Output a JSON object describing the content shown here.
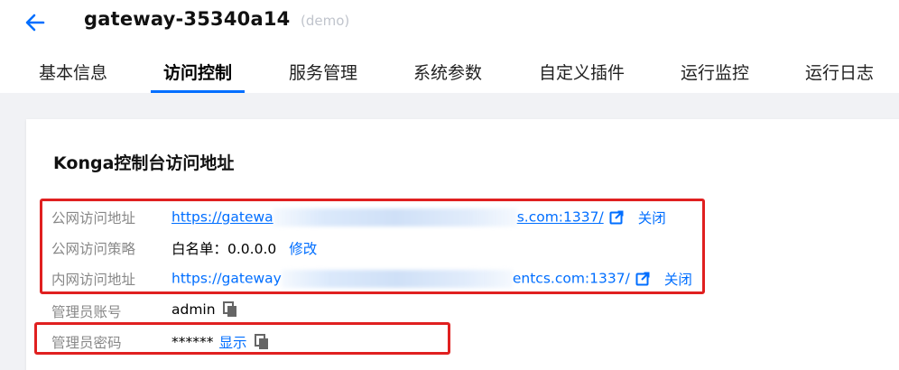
{
  "header": {
    "title": "gateway-35340a14",
    "tag": "(demo)"
  },
  "tabs": [
    {
      "label": "基本信息"
    },
    {
      "label": "访问控制"
    },
    {
      "label": "服务管理"
    },
    {
      "label": "系统参数"
    },
    {
      "label": "自定义插件"
    },
    {
      "label": "运行监控"
    },
    {
      "label": "运行日志"
    }
  ],
  "card": {
    "title": "Konga控制台访问地址",
    "rows": [
      {
        "label": "公网访问地址",
        "url_prefix": "https://gatewa",
        "url_suffix": "s.com:1337/",
        "action": "关闭"
      },
      {
        "label": "公网访问策略",
        "value": "白名单：0.0.0.0",
        "action": "修改"
      },
      {
        "label": "内网访问地址",
        "url_prefix": "https://gateway",
        "url_suffix": "entcs.com:1337/",
        "action": "关闭"
      },
      {
        "label": "管理员账号",
        "value": "admin"
      },
      {
        "label": "管理员密码",
        "value": "******",
        "action": "显示"
      }
    ]
  },
  "colors": {
    "accent": "#006eff",
    "highlight_border": "#e02020",
    "page_background": "#f1f2f5"
  },
  "icons": [
    "back-arrow-icon",
    "external-link-icon",
    "copy-icon"
  ]
}
